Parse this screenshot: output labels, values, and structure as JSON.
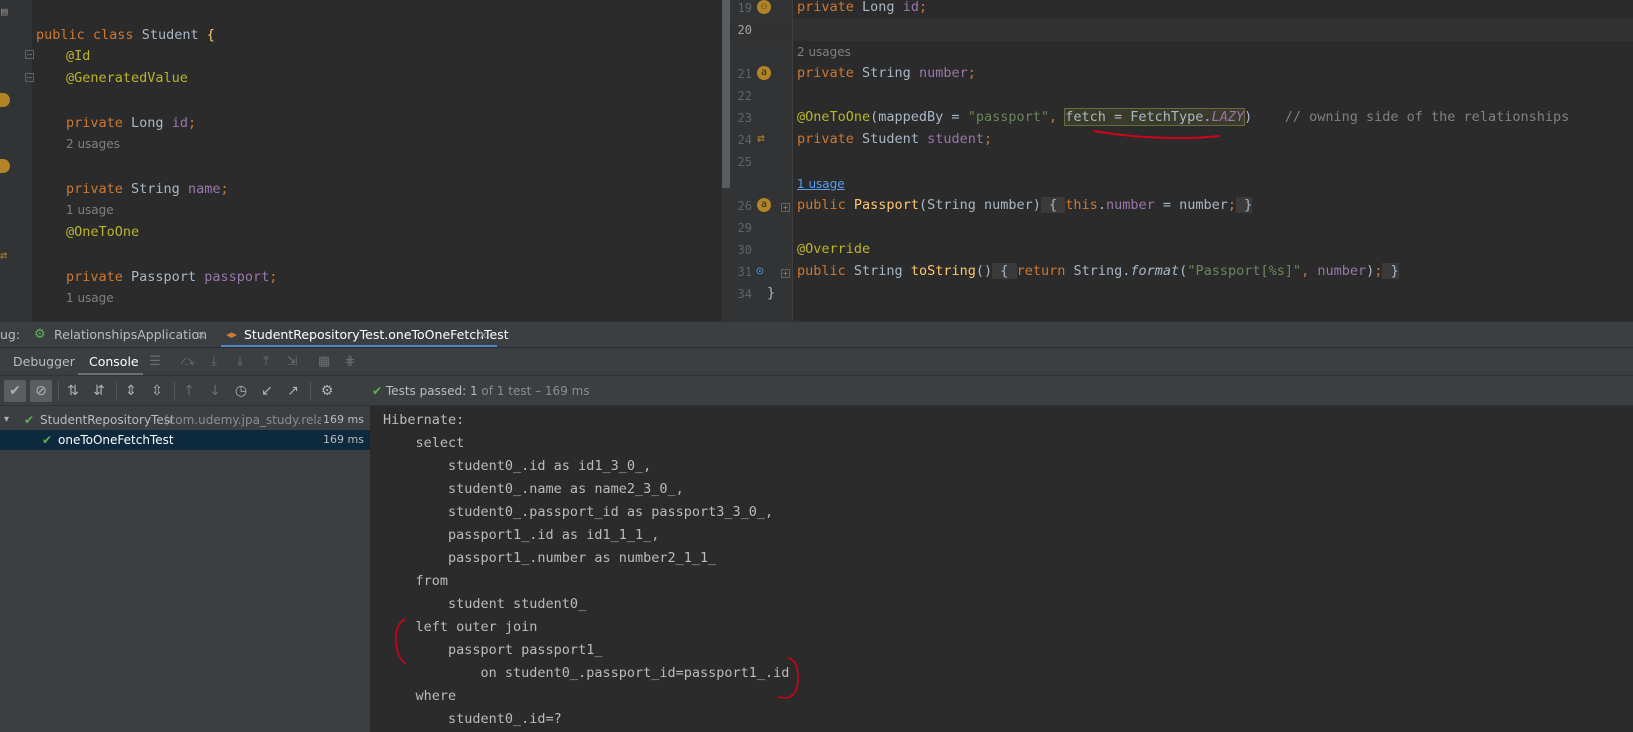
{
  "left_editor": {
    "line1": {
      "kw": "public class",
      "name": "Student",
      "brace": "{"
    },
    "ann_id": "@Id",
    "ann_gen": "@GeneratedValue",
    "id_line": {
      "kw": "private",
      "type": "Long",
      "field": "id",
      "semi": ";"
    },
    "usages_2": "2 usages",
    "name_line": {
      "kw": "private",
      "type": "String",
      "field": "name",
      "semi": ";"
    },
    "usage_1": "1 usage",
    "ann_oto": "@OneToOne",
    "passport_line": {
      "kw": "private",
      "type": "Passport",
      "field": "passport",
      "semi": ";"
    },
    "usage_1b": "1 usage"
  },
  "right_editor": {
    "line_numbers": [
      "19",
      "20",
      "21",
      "22",
      "23",
      "24",
      "25",
      "26",
      "29",
      "30",
      "31",
      "34"
    ],
    "l19": {
      "kw": "private",
      "type": "Long",
      "field": "id",
      "semi": ";"
    },
    "usages_2": "2 usages",
    "l21": {
      "kw": "private",
      "type": "String",
      "field": "number",
      "semi": ";"
    },
    "l23": {
      "ann": "@OneToOne",
      "p1": "(mappedBy = ",
      "str": "\"passport\"",
      "comma": ",",
      "fetch": "fetch = FetchType.",
      "lazy": "LAZY",
      "close": ")",
      "comment": "// owning side of the relationships"
    },
    "l24": {
      "kw": "private",
      "type": "Student",
      "field": "student",
      "semi": ";"
    },
    "usage_link": "1 usage",
    "l26": {
      "kw": "public",
      "method": "Passport",
      "params": "(String number)",
      "open": "{",
      "this": "this",
      "dot": ".",
      "field": "number",
      "rest": " = number",
      "semi": ";",
      "close": "}"
    },
    "l30": "@Override",
    "l31": {
      "kw": "public",
      "type": "String",
      "method": "toString",
      "paren": "()",
      "open": "{",
      "ret": "return",
      "cls": "String.",
      "fmt": "format",
      "p": "(",
      "str": "\"Passport[%s]\"",
      "comma": ",",
      "field": "number",
      "end": ")",
      "semi": ";",
      "close": "}"
    },
    "l34": "}"
  },
  "debug": {
    "label": "ug:",
    "tabs": [
      {
        "label": "RelationshipsApplication"
      },
      {
        "label": "StudentRepositoryTest.oneToOneFetchTest"
      }
    ],
    "subtabs": [
      "Debugger",
      "Console"
    ],
    "tests_passed_label": "Tests passed:",
    "tests_passed_count": "1",
    "tests_total": "of 1 test",
    "tests_time": "– 169 ms",
    "tree": [
      {
        "name": "StudentRepositoryTest",
        "pkg": "(com.udemy.jpa_study.relation",
        "time": "169 ms"
      },
      {
        "name": "oneToOneFetchTest",
        "time": "169 ms"
      }
    ]
  },
  "console_lines": [
    "Hibernate: ",
    "    select",
    "        student0_.id as id1_3_0_,",
    "        student0_.name as name2_3_0_,",
    "        student0_.passport_id as passport3_3_0_,",
    "        passport1_.id as id1_1_1_,",
    "        passport1_.number as number2_1_1_ ",
    "    from",
    "        student student0_ ",
    "    left outer join",
    "        passport passport1_ ",
    "            on student0_.passport_id=passport1_.id ",
    "    where",
    "        student0_.id=?"
  ],
  "colors": {
    "keyword": "#cc7832",
    "annotation": "#bbb529",
    "string": "#6a8759",
    "field": "#9876aa",
    "method": "#ffc66d",
    "annotation_red": "#d0021b",
    "pass_green": "#5fb157"
  }
}
